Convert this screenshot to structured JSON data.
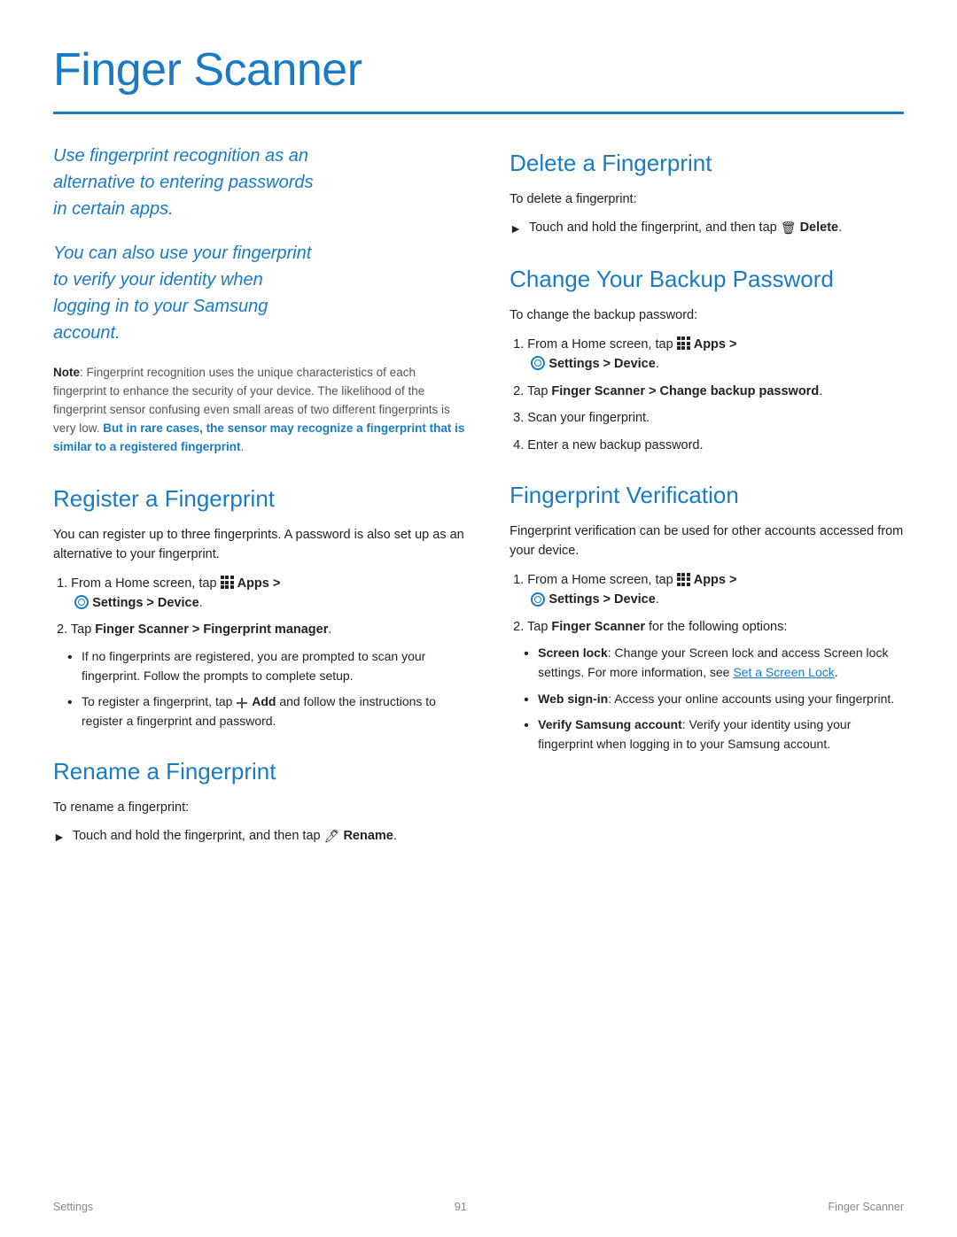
{
  "page": {
    "title": "Finger Scanner",
    "footer_left": "Settings",
    "footer_center": "91",
    "footer_right": "Finger Scanner"
  },
  "intro": {
    "line1": "Use fingerprint recognition as an",
    "line2": "alternative to entering passwords",
    "line3": "in certain apps.",
    "line4": "You can also use your fingerprint",
    "line5": "to verify your identity when",
    "line6": "logging in to your Samsung",
    "line7": "account."
  },
  "note": {
    "label": "Note",
    "text1": ": Fingerprint recognition uses the unique characteristics of each fingerprint to enhance the security of your device. The likelihood of the fingerprint sensor confusing even small areas of two different fingerprints is very low. ",
    "bold_blue": "But in rare cases, the sensor may recognize a fingerprint that is similar to a registered fingerprint",
    "end": "."
  },
  "register": {
    "title": "Register a Fingerprint",
    "body": "You can register up to three fingerprints. A password is also set up as an alternative to your fingerprint.",
    "step1": "From a Home screen, tap",
    "step1b": "Apps >",
    "step1c": "Settings > Device",
    "step1_end": ".",
    "step2": "Tap",
    "step2b": "Finger Scanner > Fingerprint manager",
    "step2_end": ".",
    "bullet1": "If no fingerprints are registered, you are prompted to scan your fingerprint. Follow the prompts to complete setup.",
    "bullet2_pre": "To register a fingerprint, tap",
    "bullet2_add": "Add",
    "bullet2_post": "and follow the instructions to register a fingerprint and password."
  },
  "rename": {
    "title": "Rename a Fingerprint",
    "body": "To rename a fingerprint:",
    "arrow": "Touch and hold the fingerprint, and then tap",
    "arrow_icon_label": "rename-icon",
    "arrow_bold": "Rename",
    "arrow_end": "."
  },
  "delete": {
    "title": "Delete a Fingerprint",
    "body": "To delete a fingerprint:",
    "arrow": "Touch and hold the fingerprint, and then tap",
    "arrow_icon_label": "trash-icon",
    "arrow_bold": "Delete",
    "arrow_end": "."
  },
  "change_backup": {
    "title": "Change Your Backup Password",
    "body": "To change the backup password:",
    "step1": "From a Home screen, tap",
    "step1b": "Apps >",
    "step1c": "Settings > Device",
    "step1_end": ".",
    "step2": "Tap",
    "step2b": "Finger Scanner > Change backup password",
    "step2_end": ".",
    "step3": "Scan your fingerprint.",
    "step4": "Enter a new backup password."
  },
  "fingerprint_verification": {
    "title": "Fingerprint Verification",
    "body": "Fingerprint verification can be used for other accounts accessed from your device.",
    "step1": "From a Home screen, tap",
    "step1b": "Apps >",
    "step1c": "Settings > Device",
    "step1_end": ".",
    "step2_pre": "Tap",
    "step2_bold": "Finger Scanner",
    "step2_post": "for the following options:",
    "bullet1_bold": "Screen lock",
    "bullet1_text": ": Change your Screen lock and access Screen lock settings. For more information, see",
    "bullet1_link": "Set a Screen Lock",
    "bullet1_end": ".",
    "bullet2_bold": "Web sign-in",
    "bullet2_text": ": Access your online accounts using your fingerprint.",
    "bullet3_bold": "Verify Samsung account",
    "bullet3_text": ": Verify your identity using your fingerprint when logging in to your Samsung account."
  }
}
